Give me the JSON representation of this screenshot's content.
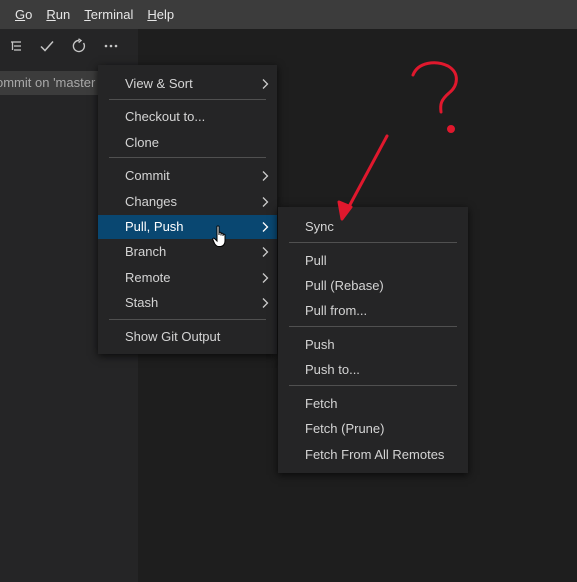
{
  "menubar": {
    "items": [
      {
        "mnemonic": "G",
        "rest": "o"
      },
      {
        "mnemonic": "R",
        "rest": "un"
      },
      {
        "mnemonic": "T",
        "rest": "erminal"
      },
      {
        "mnemonic": "H",
        "rest": "elp"
      }
    ]
  },
  "scm": {
    "commit_placeholder": "ommit on 'master"
  },
  "main_menu": {
    "items": [
      "View & Sort",
      "Checkout to...",
      "Clone",
      "Commit",
      "Changes",
      "Pull, Push",
      "Branch",
      "Remote",
      "Stash",
      "Show Git Output"
    ]
  },
  "sub_menu": {
    "items": [
      "Sync",
      "Pull",
      "Pull (Rebase)",
      "Pull from...",
      "Push",
      "Push to...",
      "Fetch",
      "Fetch (Prune)",
      "Fetch From All Remotes"
    ]
  },
  "annotation": {
    "color": "#e0182d"
  }
}
